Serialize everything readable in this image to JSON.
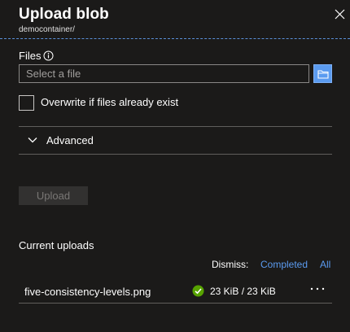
{
  "panel": {
    "title": "Upload blob",
    "subtitle": "democontainer/"
  },
  "form": {
    "files_label": "Files",
    "file_placeholder": "Select a file",
    "overwrite_label": "Overwrite if files already exist",
    "overwrite_checked": false,
    "advanced_label": "Advanced",
    "upload_button": "Upload"
  },
  "uploads": {
    "heading": "Current uploads",
    "dismiss_label": "Dismiss:",
    "dismiss_completed": "Completed",
    "dismiss_all": "All",
    "items": [
      {
        "file_name": "five-consistency-levels.png",
        "status": "completed",
        "progress": "23 KiB / 23 KiB"
      }
    ]
  },
  "icons": {
    "close": "close-icon",
    "info": "info-icon",
    "browse": "folder-icon",
    "advanced": "chevron-down-icon",
    "status": "check-circle-icon",
    "more": "more-icon"
  },
  "colors": {
    "background": "#1b1a19",
    "accent": "#5b9bf0",
    "success": "#57a300",
    "divider": "#605e5c"
  }
}
